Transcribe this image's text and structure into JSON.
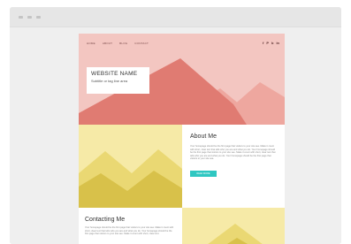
{
  "nav": [
    "HOME",
    "ABOUT",
    "BLOG",
    "CONTACT"
  ],
  "social_icons": [
    "f",
    "P",
    "b",
    "in"
  ],
  "hero": {
    "title": "WEBSITE NAME",
    "subtitle": "Subtitle or tag line area"
  },
  "about": {
    "heading": "About Me",
    "paragraph": "Your homepage should be the first page that visitors to your site see. Make it count with short, clear text that tells who you are and what you do. Your homepage should be the first page that visitors to your site see. Make it count with short, clear text that tells who you are and what you do. Your homepage should be the first page that visitors to your site see.",
    "button_label": "READ MORE"
  },
  "contact": {
    "heading": "Contacting Me",
    "paragraph": "Your homepage should be the first page that visitors to your site see. Make it count with short, clear text that tells who you are and what you do. Your homepage should be the first page that visitors to your site see. Make it count with short, clear text."
  },
  "colors": {
    "hero_bg": "#f3c6c1",
    "hero_mountain_main": "#e07b72",
    "hero_mountain_light": "#eea79f",
    "yellow_bg": "#f6eaa7",
    "yellow_mid": "#ead873",
    "yellow_dark": "#d8c14a",
    "accent_teal": "#2fc7c1"
  }
}
